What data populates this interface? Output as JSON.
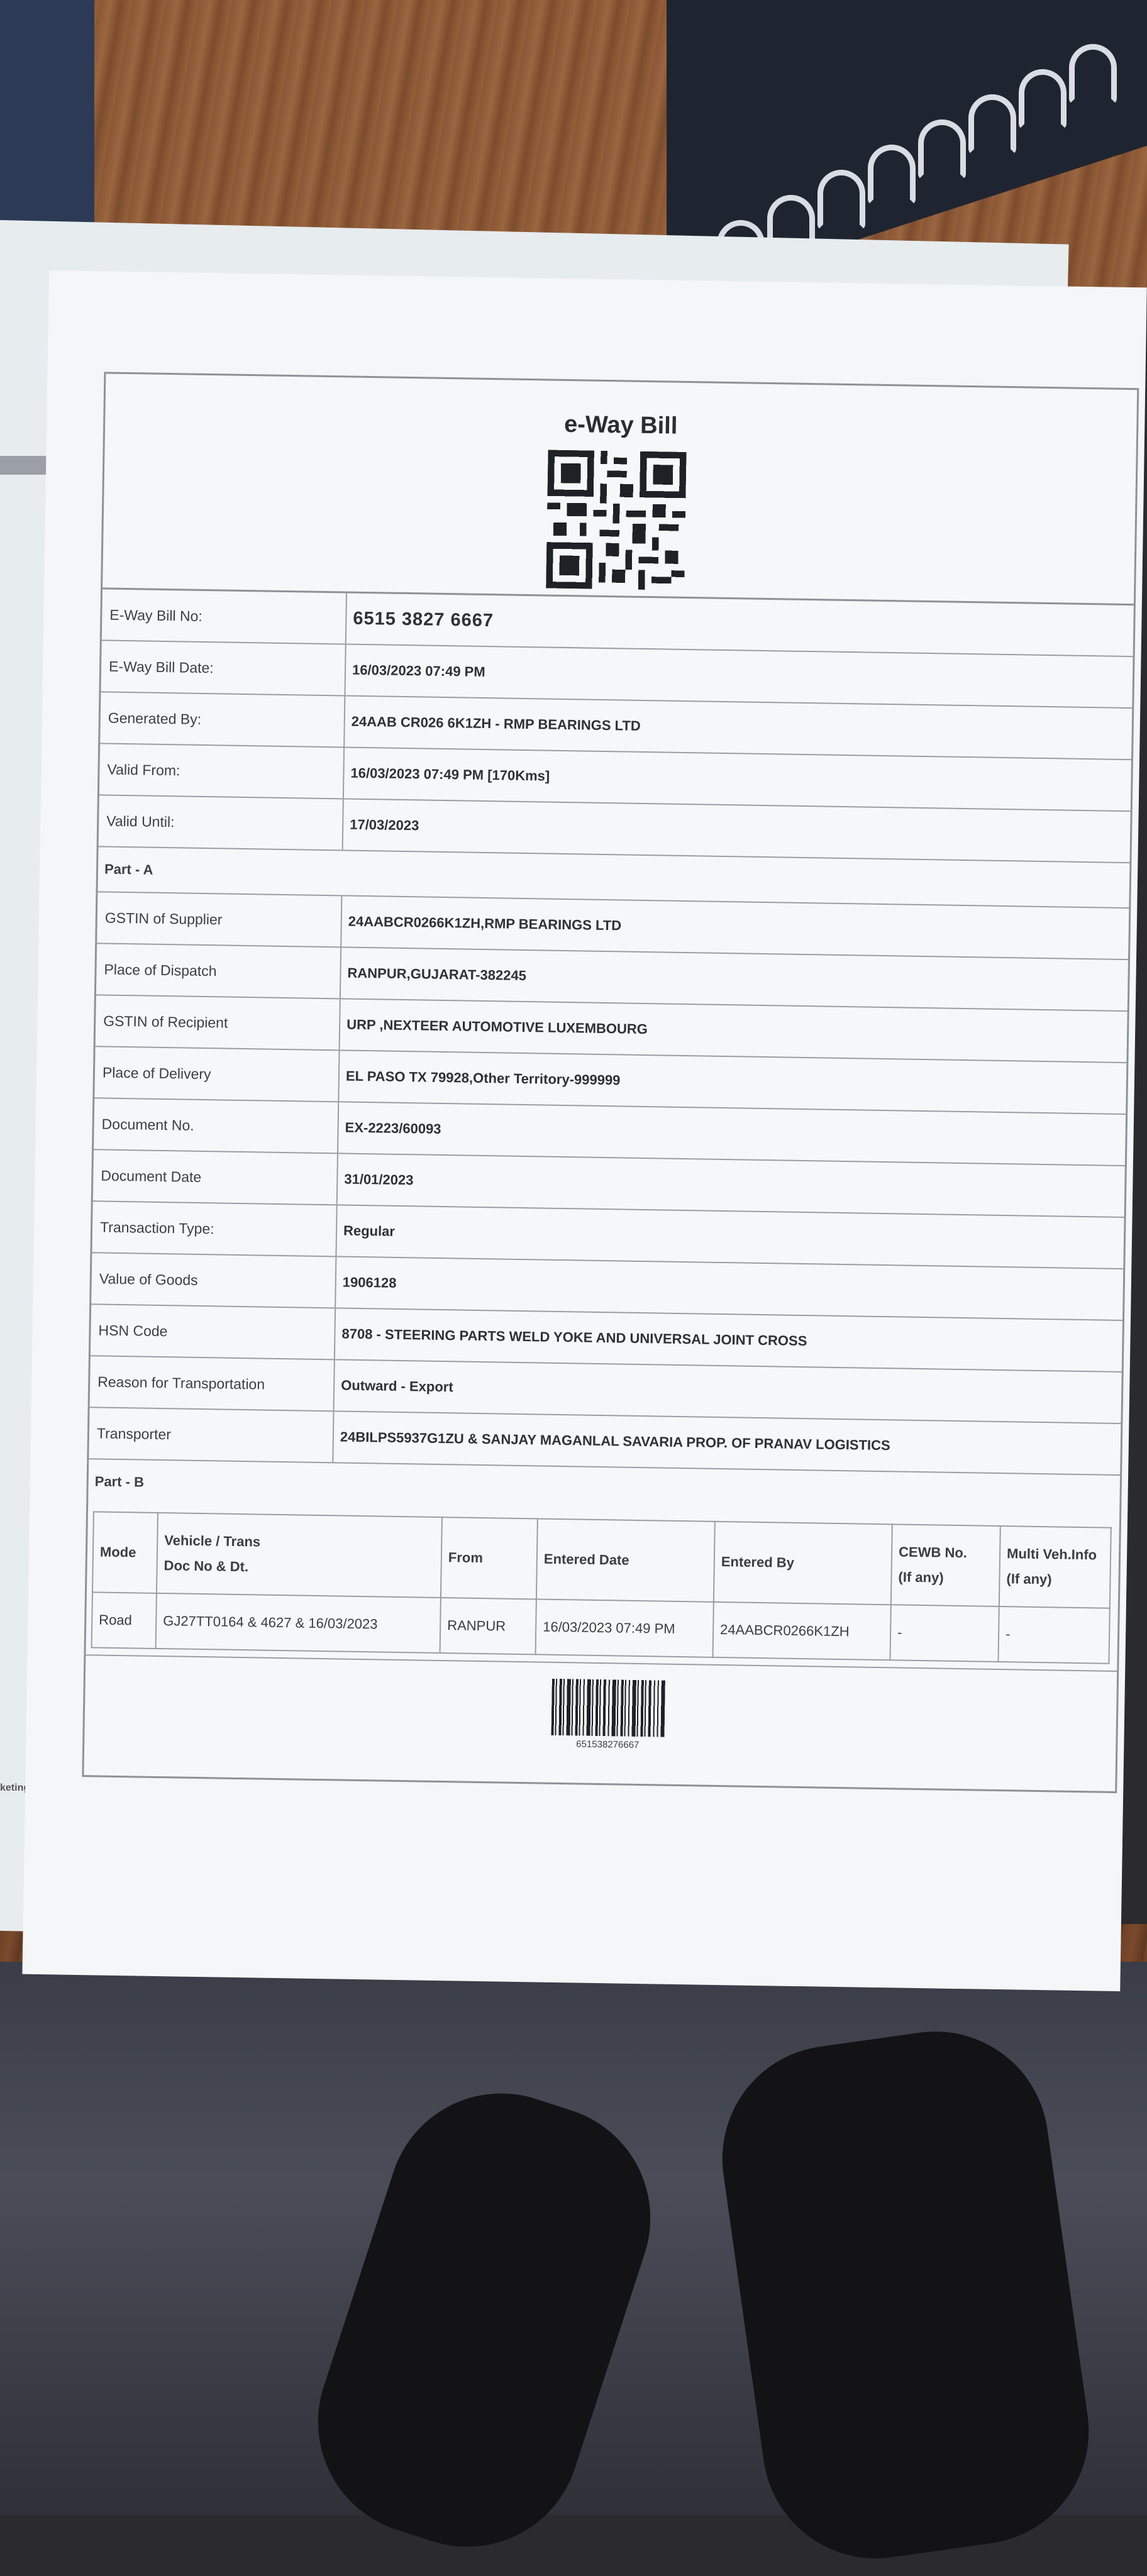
{
  "document": {
    "title": "e-Way Bill",
    "fields": [
      {
        "label": "E-Way Bill No:",
        "value": "6515 3827 6667"
      },
      {
        "label": "E-Way Bill Date:",
        "value": "16/03/2023 07:49 PM"
      },
      {
        "label": "Generated By:",
        "value": "24AAB CR026 6K1ZH - RMP BEARINGS LTD"
      },
      {
        "label": "Valid From:",
        "value": "16/03/2023 07:49 PM [170Kms]"
      },
      {
        "label": "Valid Until:",
        "value": "17/03/2023"
      }
    ],
    "part_a": {
      "heading": "Part - A",
      "fields": [
        {
          "label": "GSTIN of Supplier",
          "value": "24AABCR0266K1ZH,RMP BEARINGS LTD"
        },
        {
          "label": "Place of Dispatch",
          "value": "RANPUR,GUJARAT-382245"
        },
        {
          "label": "GSTIN of Recipient",
          "value": "URP ,NEXTEER AUTOMOTIVE LUXEMBOURG"
        },
        {
          "label": "Place of Delivery",
          "value": "EL PASO TX 79928,Other Territory-999999"
        },
        {
          "label": "Document No.",
          "value": "EX-2223/60093"
        },
        {
          "label": "Document Date",
          "value": "31/01/2023"
        },
        {
          "label": "Transaction Type:",
          "value": "Regular"
        },
        {
          "label": "Value of Goods",
          "value": "1906128"
        },
        {
          "label": "HSN Code",
          "value": "8708 - STEERING PARTS WELD YOKE AND UNIVERSAL JOINT CROSS"
        },
        {
          "label": "Reason for Transportation",
          "value": "Outward - Export"
        },
        {
          "label": "Transporter",
          "value": "24BILPS5937G1ZU & SANJAY MAGANLAL SAVARIA PROP. OF PRANAV LOGISTICS"
        }
      ]
    },
    "part_b": {
      "heading": "Part - B",
      "columns": [
        "Mode",
        "Vehicle / Trans\nDoc No & Dt.",
        "From",
        "Entered Date",
        "Entered By",
        "CEWB No.\n(If any)",
        "Multi Veh.Info\n(If any)"
      ],
      "rows": [
        [
          "Road",
          "GJ27TT0164 & 4627 & 16/03/2023",
          "RANPUR",
          "16/03/2023 07:49 PM",
          "24AABCR0266K1ZH",
          "-",
          "-"
        ]
      ]
    },
    "barcode_number": "651538276667"
  },
  "side_text": "keting"
}
